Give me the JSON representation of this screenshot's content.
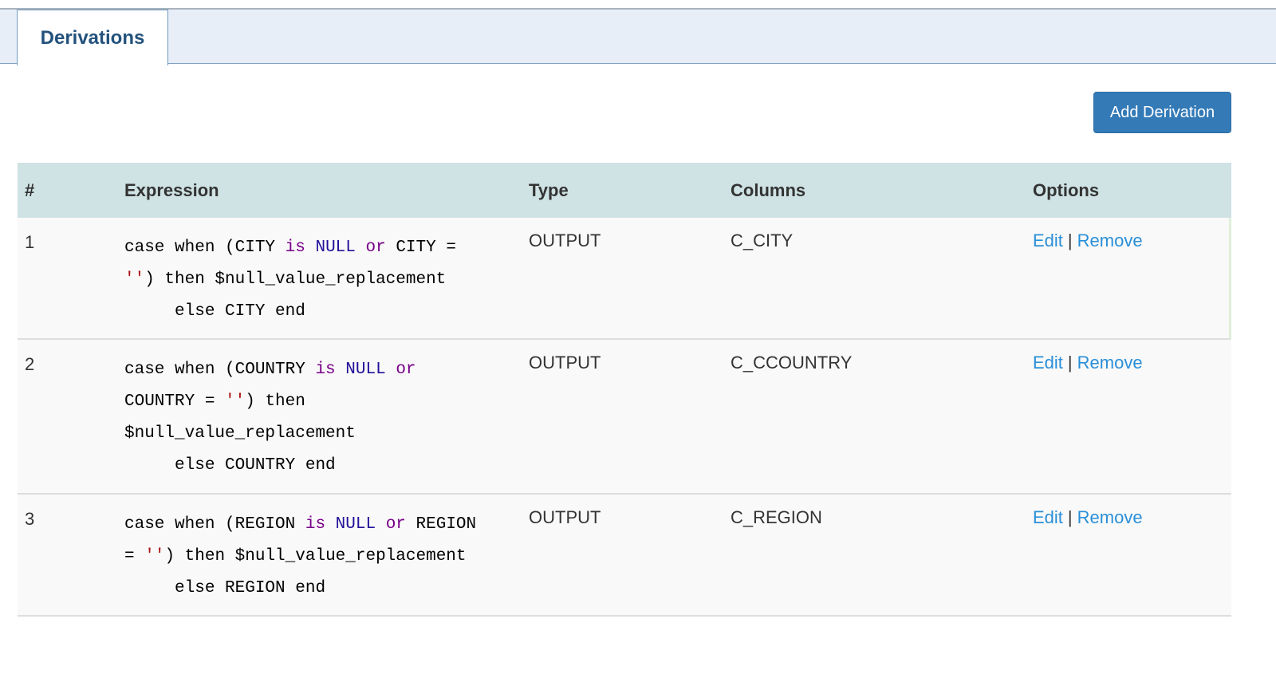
{
  "tabs": [
    {
      "label": "Derivations",
      "active": true
    }
  ],
  "add_button_label": "Add Derivation",
  "table": {
    "headers": [
      "#",
      "Expression",
      "Type",
      "Columns",
      "Options"
    ],
    "rows": [
      {
        "num": "1",
        "expr": {
          "l1a": "case when (CITY ",
          "l1b": "is",
          "l1c": " ",
          "l1d": "NULL",
          "l1e": " ",
          "l1f": "or",
          "l1g": " CITY =",
          "l2a": "''",
          "l2b": ") then $null_value_replacement",
          "l3": "     else CITY end"
        },
        "type": "OUTPUT",
        "columns": "C_CITY",
        "edit": "Edit",
        "remove": "Remove"
      },
      {
        "num": "2",
        "expr": {
          "l1a": "case when (COUNTRY ",
          "l1b": "is",
          "l1c": " ",
          "l1d": "NULL",
          "l1e": " ",
          "l1f": "or",
          "l2a": "COUNTRY = ",
          "l2b": "''",
          "l2c": ") then",
          "l3": "$null_value_replacement",
          "l4": "     else COUNTRY end"
        },
        "type": "OUTPUT",
        "columns": "C_CCOUNTRY",
        "edit": "Edit",
        "remove": "Remove"
      },
      {
        "num": "3",
        "expr": {
          "l1a": "case when (REGION ",
          "l1b": "is",
          "l1c": " ",
          "l1d": "NULL",
          "l1e": " ",
          "l1f": "or",
          "l1g": " REGION",
          "l2a": "= ",
          "l2b": "''",
          "l2c": ") then $null_value_replacement",
          "l3": "     else REGION end"
        },
        "type": "OUTPUT",
        "columns": "C_REGION",
        "edit": "Edit",
        "remove": "Remove"
      }
    ]
  },
  "options_separator": "|",
  "colors": {
    "primary": "#337ab7",
    "link": "#2a8fd8",
    "header_bg": "#cfe2e4",
    "keyword": "#770088",
    "null_literal": "#221199",
    "string_literal": "#aa1111"
  }
}
